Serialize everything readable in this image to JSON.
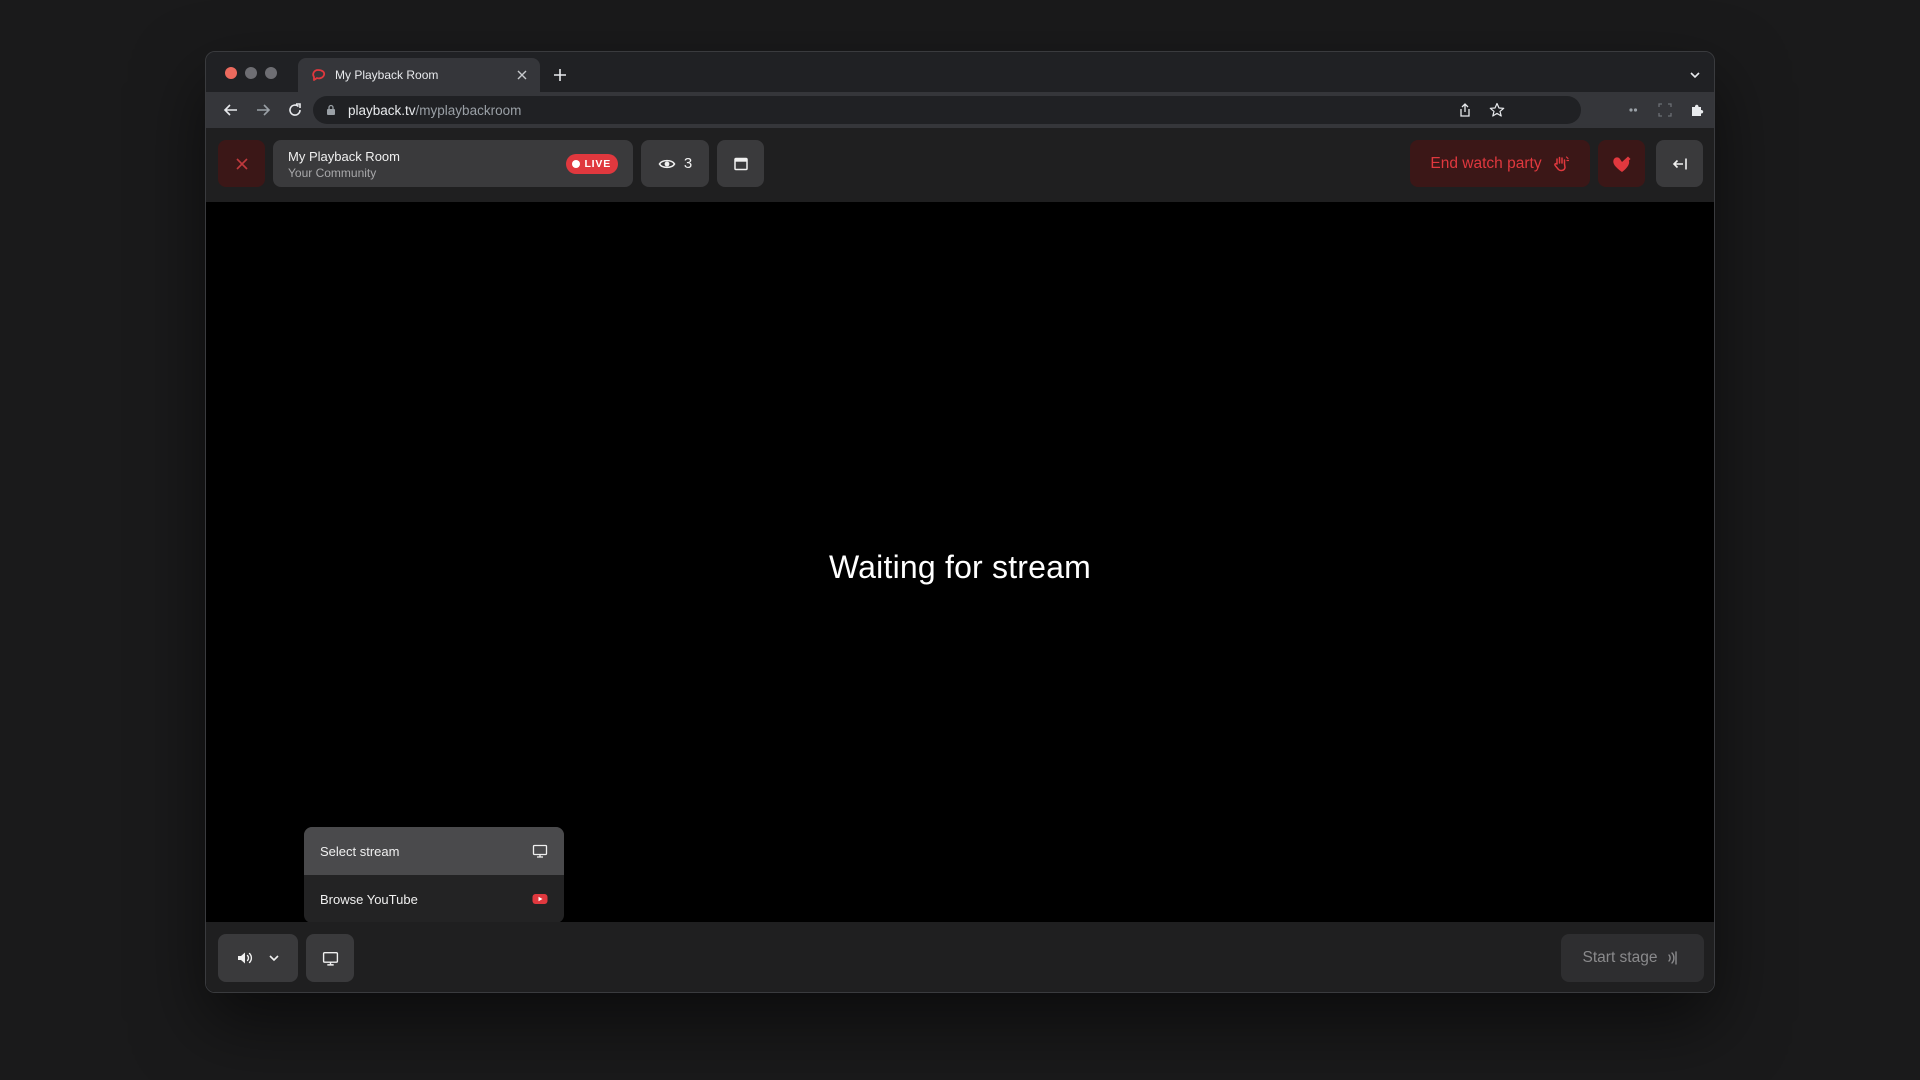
{
  "browser": {
    "tab_title": "My Playback Room",
    "url_host": "playback.tv",
    "url_path": "/myplaybackroom"
  },
  "room": {
    "name": "My Playback Room",
    "community": "Your Community",
    "live_label": "LIVE",
    "viewer_count": "3"
  },
  "actions": {
    "end_watch_party": "End watch party",
    "start_stage": "Start stage"
  },
  "stage": {
    "status": "Waiting for stream"
  },
  "source_menu": {
    "items": [
      {
        "label": "Select stream",
        "icon": "monitor-icon",
        "selected": true
      },
      {
        "label": "Browse YouTube",
        "icon": "youtube-icon",
        "selected": false
      }
    ]
  },
  "colors": {
    "accent_red": "#e0383e",
    "danger_bg": "#3b1717",
    "surface": "#3a3a3c",
    "bar": "#1f1f20",
    "stage": "#000000"
  },
  "icons": {
    "favicon": "playback-logo-icon",
    "top_close": "close-icon",
    "viewers": "eye-icon",
    "window": "browser-window-icon",
    "end_party": "wave-hand-icon",
    "reaction": "heart-check-icon",
    "leave": "arrow-left-bar-icon",
    "volume": "speaker-icon",
    "share": "monitor-icon",
    "stage": "broadcast-icon"
  }
}
